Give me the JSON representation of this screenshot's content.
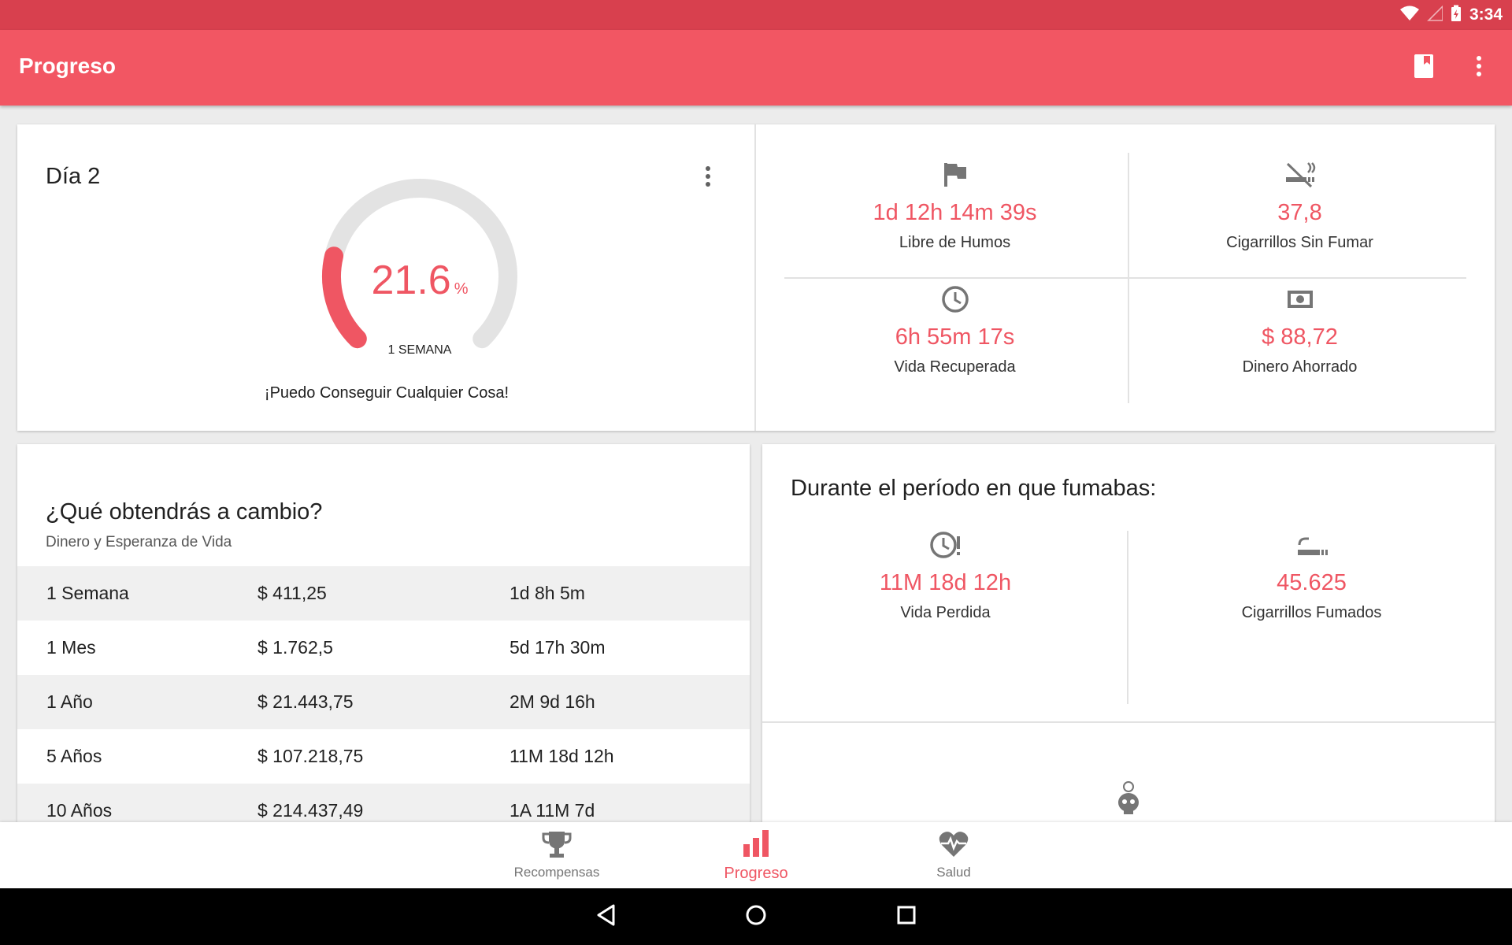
{
  "status_bar": {
    "time": "3:34"
  },
  "app_bar": {
    "title": "Progreso"
  },
  "progress_card": {
    "day_label": "Día 2",
    "gauge_value": "21.6",
    "gauge_unit": "%",
    "gauge_fraction": 0.216,
    "gauge_caption": "1 SEMANA",
    "motto": "¡Puedo Conseguir Cualquier Cosa!"
  },
  "stats": [
    {
      "icon": "flag-icon",
      "value": "1d 12h 14m 39s",
      "label": "Libre de Humos"
    },
    {
      "icon": "no-smoking-icon",
      "value": "37,8",
      "label": "Cigarrillos Sin Fumar"
    },
    {
      "icon": "clock-icon",
      "value": "6h 55m 17s",
      "label": "Vida Recuperada"
    },
    {
      "icon": "money-icon",
      "value": "$ 88,72",
      "label": "Dinero Ahorrado"
    }
  ],
  "gains": {
    "title": "¿Qué obtendrás a cambio?",
    "subtitle": "Dinero y Esperanza de Vida",
    "rows": [
      {
        "period": "1 Semana",
        "money": "$ 411,25",
        "life": "1d 8h 5m"
      },
      {
        "period": "1 Mes",
        "money": "$ 1.762,5",
        "life": "5d 17h 30m"
      },
      {
        "period": "1 Año",
        "money": "$ 21.443,75",
        "life": "2M 9d 16h"
      },
      {
        "period": "5 Años",
        "money": "$ 107.218,75",
        "life": "11M 18d 12h"
      },
      {
        "period": "10 Años",
        "money": "$ 214.437,49",
        "life": "1A 11M 7d"
      }
    ]
  },
  "smoking_period": {
    "title": "Durante el período en que fumabas:",
    "stats": [
      {
        "icon": "clock-alert-icon",
        "value": "11M 18d 12h",
        "label": "Vida Perdida"
      },
      {
        "icon": "cigarette-icon",
        "value": "45.625",
        "label": "Cigarrillos Fumados"
      }
    ]
  },
  "bottom_nav": [
    {
      "icon": "trophy-icon",
      "label": "Recompensas",
      "active": false
    },
    {
      "icon": "bar-chart-icon",
      "label": "Progreso",
      "active": true
    },
    {
      "icon": "heart-pulse-icon",
      "label": "Salud",
      "active": false
    }
  ],
  "colors": {
    "accent": "#ef5663",
    "app_bar": "#f25663",
    "status_bar": "#d8404e",
    "icon_gray": "#757575"
  }
}
